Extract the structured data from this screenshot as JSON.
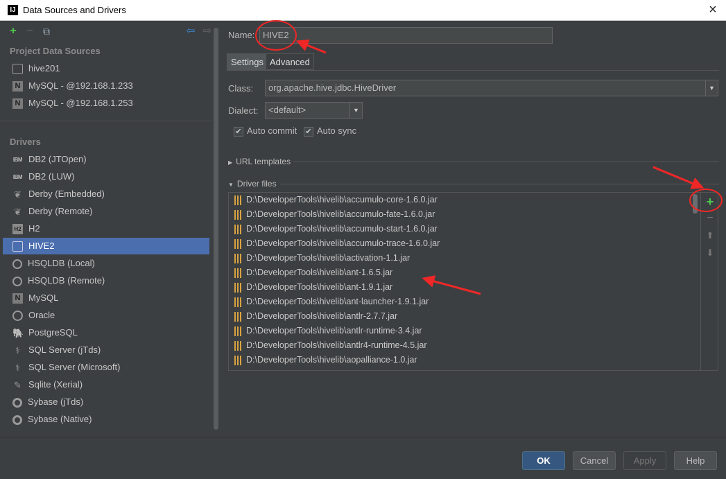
{
  "window": {
    "title": "Data Sources and Drivers",
    "app_icon": "intellij-icon",
    "close_label": "×"
  },
  "sidebar": {
    "toolbar": {
      "add": "+",
      "remove": "−",
      "copy": "⧉",
      "back": "⇦",
      "forward": "⇨"
    },
    "project_header": "Project Data Sources",
    "project_items": [
      {
        "label": "hive201",
        "icon": "hive-icon"
      },
      {
        "label": "MySQL - @192.168.1.233",
        "icon": "mysql-icon"
      },
      {
        "label": "MySQL - @192.168.1.253",
        "icon": "mysql-icon"
      }
    ],
    "drivers_header": "Drivers",
    "driver_items": [
      {
        "label": "DB2 (JTOpen)",
        "icon": "ibm-icon"
      },
      {
        "label": "DB2 (LUW)",
        "icon": "ibm-icon"
      },
      {
        "label": "Derby (Embedded)",
        "icon": "derby-icon"
      },
      {
        "label": "Derby (Remote)",
        "icon": "derby-icon"
      },
      {
        "label": "H2",
        "icon": "h2-icon"
      },
      {
        "label": "HIVE2",
        "icon": "hive-icon"
      },
      {
        "label": "HSQLDB (Local)",
        "icon": "hsqldb-icon"
      },
      {
        "label": "HSQLDB (Remote)",
        "icon": "hsqldb-icon"
      },
      {
        "label": "MySQL",
        "icon": "mysql-icon"
      },
      {
        "label": "Oracle",
        "icon": "oracle-icon"
      },
      {
        "label": "PostgreSQL",
        "icon": "postgresql-icon"
      },
      {
        "label": "SQL Server (jTds)",
        "icon": "sqlserver-icon"
      },
      {
        "label": "SQL Server (Microsoft)",
        "icon": "sqlserver-icon"
      },
      {
        "label": "Sqlite (Xerial)",
        "icon": "sqlite-icon"
      },
      {
        "label": "Sybase (jTds)",
        "icon": "sybase-icon"
      },
      {
        "label": "Sybase (Native)",
        "icon": "sybase-icon"
      }
    ],
    "selected_driver": "HIVE2"
  },
  "main": {
    "name_label": "Name:",
    "name_value": "HIVE2",
    "tabs": [
      {
        "label": "Settings"
      },
      {
        "label": "Advanced"
      }
    ],
    "active_tab": "Settings",
    "class_label": "Class:",
    "class_value": "org.apache.hive.jdbc.HiveDriver",
    "dialect_label": "Dialect:",
    "dialect_value": "<default>",
    "auto_commit": {
      "label": "Auto commit",
      "checked": true
    },
    "auto_sync": {
      "label": "Auto sync",
      "checked": true
    },
    "url_templates_label": "URL templates",
    "driver_files_label": "Driver files",
    "driver_files": [
      "D:\\DeveloperTools\\hivelib\\accumulo-core-1.6.0.jar",
      "D:\\DeveloperTools\\hivelib\\accumulo-fate-1.6.0.jar",
      "D:\\DeveloperTools\\hivelib\\accumulo-start-1.6.0.jar",
      "D:\\DeveloperTools\\hivelib\\accumulo-trace-1.6.0.jar",
      "D:\\DeveloperTools\\hivelib\\activation-1.1.jar",
      "D:\\DeveloperTools\\hivelib\\ant-1.6.5.jar",
      "D:\\DeveloperTools\\hivelib\\ant-1.9.1.jar",
      "D:\\DeveloperTools\\hivelib\\ant-launcher-1.9.1.jar",
      "D:\\DeveloperTools\\hivelib\\antlr-2.7.7.jar",
      "D:\\DeveloperTools\\hivelib\\antlr-runtime-3.4.jar",
      "D:\\DeveloperTools\\hivelib\\antlr4-runtime-4.5.jar",
      "D:\\DeveloperTools\\hivelib\\aopalliance-1.0.jar"
    ],
    "list_tools": {
      "add": "+",
      "remove": "−",
      "up": "⬆",
      "down": "⬇"
    }
  },
  "footer": {
    "ok": "OK",
    "cancel": "Cancel",
    "apply": "Apply",
    "help": "Help"
  },
  "colors": {
    "accent": "#4b6eaf",
    "annotation": "#ef2727",
    "add_green": "#4ec94e",
    "jar": "#d9a441"
  }
}
